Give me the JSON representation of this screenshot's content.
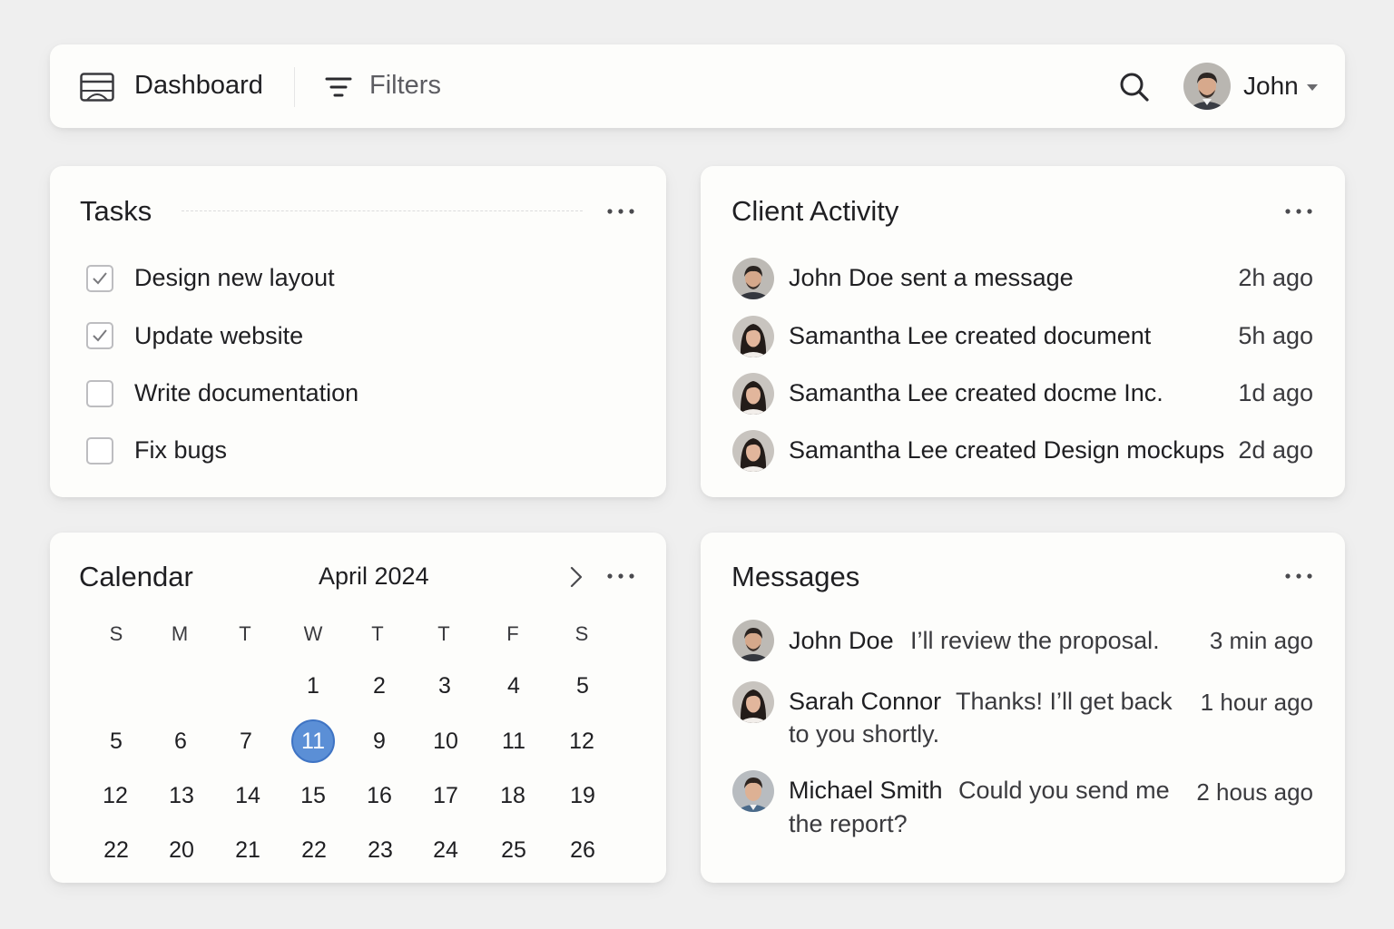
{
  "topbar": {
    "title": "Dashboard",
    "filters_label": "Filters",
    "user_name": "John"
  },
  "tasks": {
    "title": "Tasks",
    "items": [
      {
        "label": "Design new layout",
        "checked": true
      },
      {
        "label": "Update website",
        "checked": true
      },
      {
        "label": "Write documentation",
        "checked": false
      },
      {
        "label": "Fix bugs",
        "checked": false
      }
    ]
  },
  "client_activity": {
    "title": "Client Activity",
    "items": [
      {
        "text": "John Doe sent a message",
        "time": "2h ago",
        "avatar": "man"
      },
      {
        "text": "Samantha Lee created document",
        "time": "5h ago",
        "avatar": "woman"
      },
      {
        "text": "Samantha Lee created docme Inc.",
        "time": "1d ago",
        "avatar": "woman"
      },
      {
        "text": "Samantha Lee created Design mockups",
        "time": "2d ago",
        "avatar": "woman"
      }
    ]
  },
  "calendar": {
    "title": "Calendar",
    "month": "April 2024",
    "weekdays": [
      "S",
      "M",
      "T",
      "W",
      "T",
      "T",
      "F",
      "S"
    ],
    "weeks": [
      [
        "",
        "",
        "",
        "1",
        "2",
        "3",
        "4",
        "5"
      ],
      [
        "5",
        "6",
        "7",
        "11",
        "9",
        "10",
        "11",
        "12"
      ],
      [
        "12",
        "13",
        "14",
        "15",
        "16",
        "17",
        "18",
        "19"
      ],
      [
        "22",
        "20",
        "21",
        "22",
        "23",
        "24",
        "25",
        "26"
      ]
    ],
    "selected_day": "11"
  },
  "messages": {
    "title": "Messages",
    "items": [
      {
        "name": "John Doe",
        "body": "I’ll review the proposal.",
        "time": "3 min ago",
        "avatar": "man"
      },
      {
        "name": "Sarah Connor",
        "body_line1": "Thanks! I’ll get back",
        "body_line2": "to you shortly.",
        "time": "1 hour ago",
        "avatar": "woman"
      },
      {
        "name": "Michael Smith",
        "body_line1": "Could you send me",
        "body_line2": "the report?",
        "time": "2 hous ago",
        "avatar": "man2"
      }
    ]
  },
  "colors": {
    "background": "#efefef",
    "card": "#fdfdfb",
    "selected_day": "#5b8fd6",
    "text": "#1f1f22",
    "muted": "#5d5d62"
  }
}
